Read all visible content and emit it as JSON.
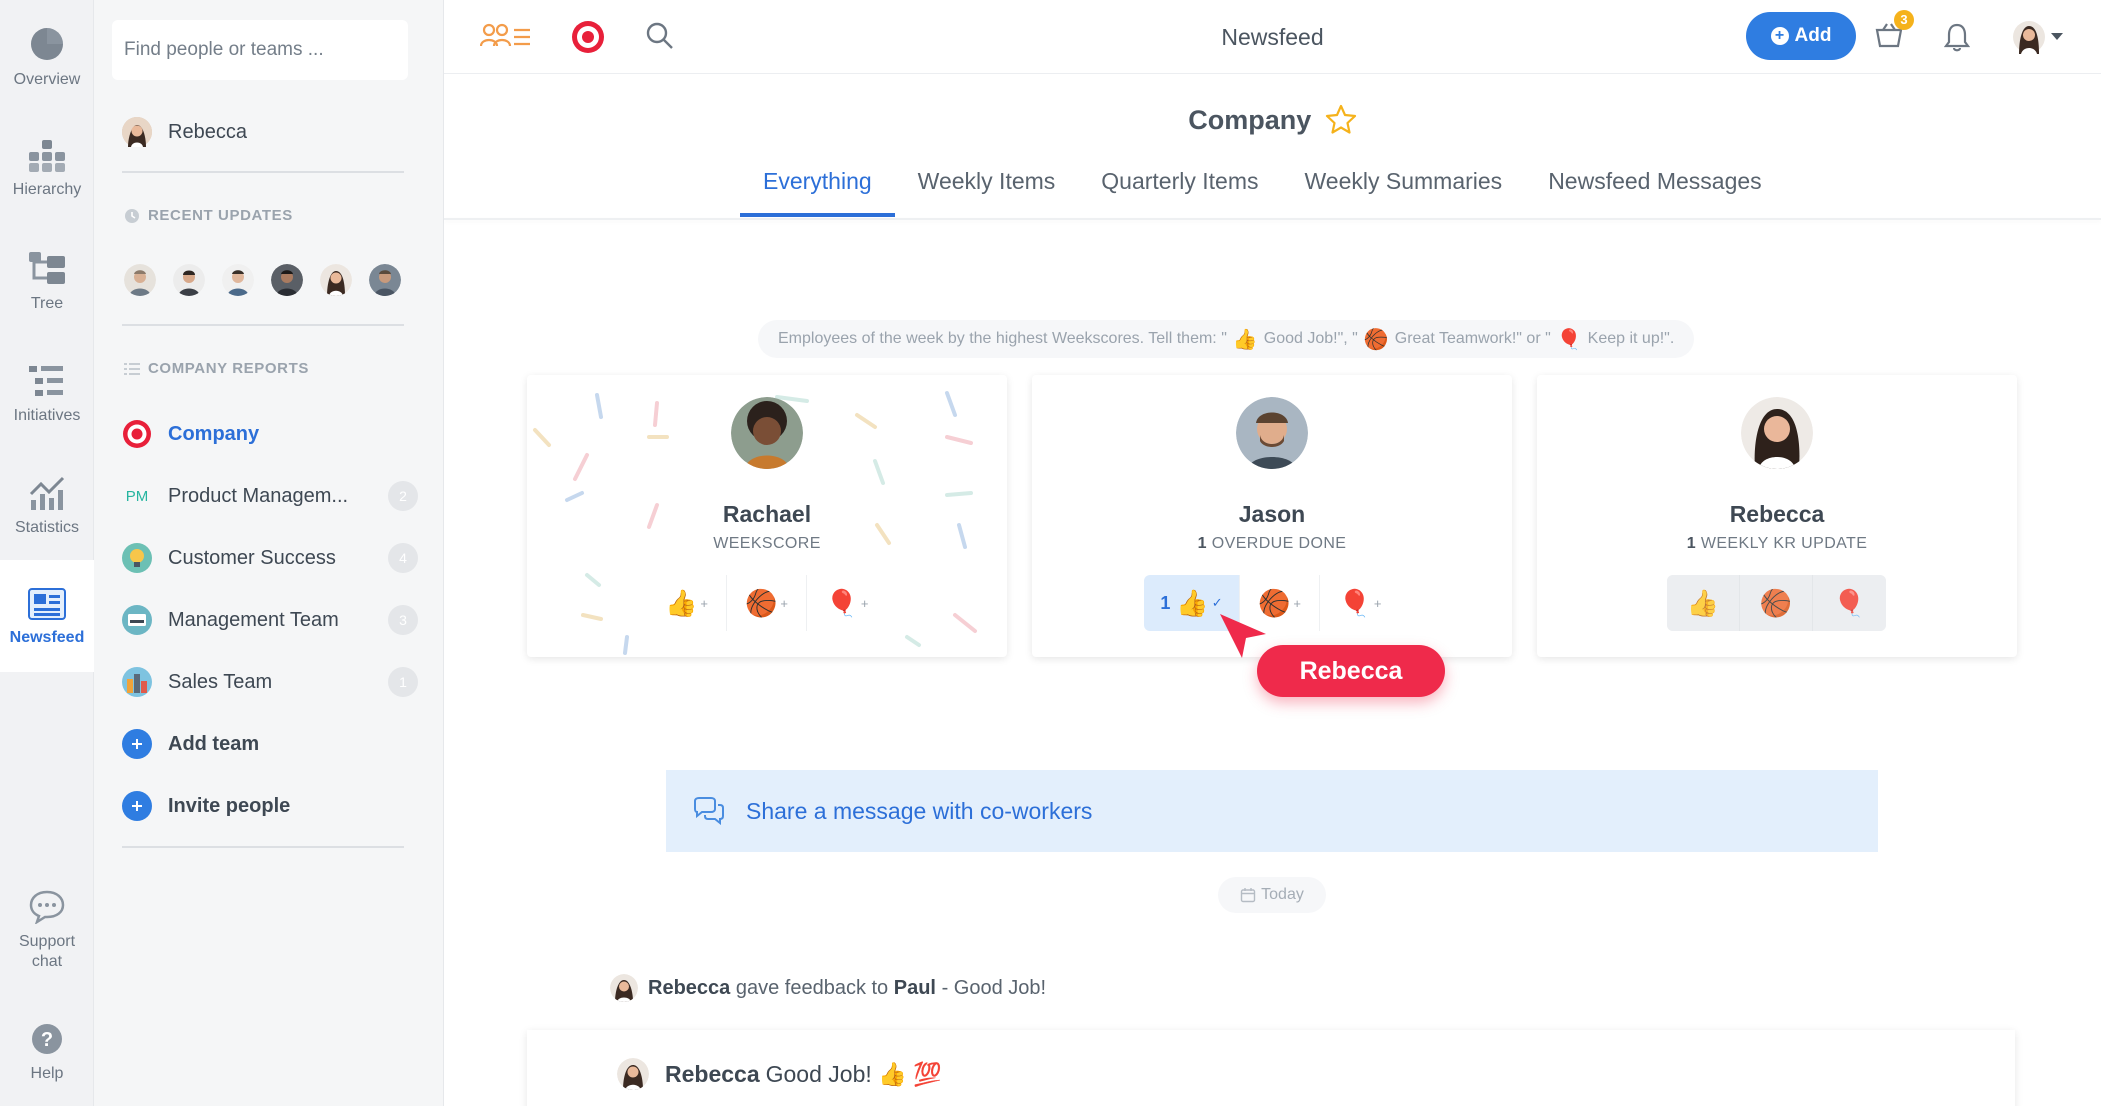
{
  "rail": {
    "items": [
      {
        "label": "Overview"
      },
      {
        "label": "Hierarchy"
      },
      {
        "label": "Tree"
      },
      {
        "label": "Initiatives"
      },
      {
        "label": "Statistics"
      },
      {
        "label": "Newsfeed"
      },
      {
        "label": "Support chat"
      },
      {
        "label": "Help"
      }
    ]
  },
  "sidebar": {
    "search_placeholder": "Find people or teams ...",
    "current_user": "Rebecca",
    "recent_updates_heading": "RECENT UPDATES",
    "company_reports_heading": "COMPANY REPORTS",
    "teams": [
      {
        "label": "Company",
        "icon": "target-icon"
      },
      {
        "label": "Product Managem...",
        "prefix": "PM",
        "count": "2"
      },
      {
        "label": "Customer Success",
        "count": "4"
      },
      {
        "label": "Management Team",
        "count": "3"
      },
      {
        "label": "Sales Team",
        "count": "1"
      }
    ],
    "add_team": "Add team",
    "invite_people": "Invite people"
  },
  "topbar": {
    "title": "Newsfeed",
    "add_label": "Add",
    "cart_badge": "3"
  },
  "page": {
    "company_title": "Company",
    "tabs": [
      "Everything",
      "Weekly Items",
      "Quarterly Items",
      "Weekly Summaries",
      "Newsfeed Messages"
    ],
    "active_tab": "Everything"
  },
  "banner": {
    "part1": "Employees of the week by the highest Weekscores. Tell them: \"",
    "part2": "Good Job!\", \"",
    "part3": "Great Teamwork!\" or \"",
    "part4": "Keep it up!\"."
  },
  "cards": [
    {
      "name": "Rachael",
      "sub_num": "",
      "sub": "WEEKSCORE"
    },
    {
      "name": "Jason",
      "sub_num": "1",
      "sub": "OVERDUE DONE",
      "thumbs_count": "1"
    },
    {
      "name": "Rebecca",
      "sub_num": "1",
      "sub": "WEEKLY KR UPDATE"
    }
  ],
  "tooltip": "Rebecca",
  "share": "Share a message with co-workers",
  "today": "Today",
  "feed": {
    "actor": "Rebecca",
    "action": "gave feedback to",
    "target": "Paul",
    "suffix": "- Good Job!"
  },
  "post": {
    "author": "Rebecca",
    "text": "Good Job!",
    "emoji": "👍 💯"
  },
  "colors": {
    "accent": "#2c6fd8",
    "brand_red": "#ef2a4b",
    "add_button": "#2f7de1",
    "badge": "#f5b21b"
  }
}
